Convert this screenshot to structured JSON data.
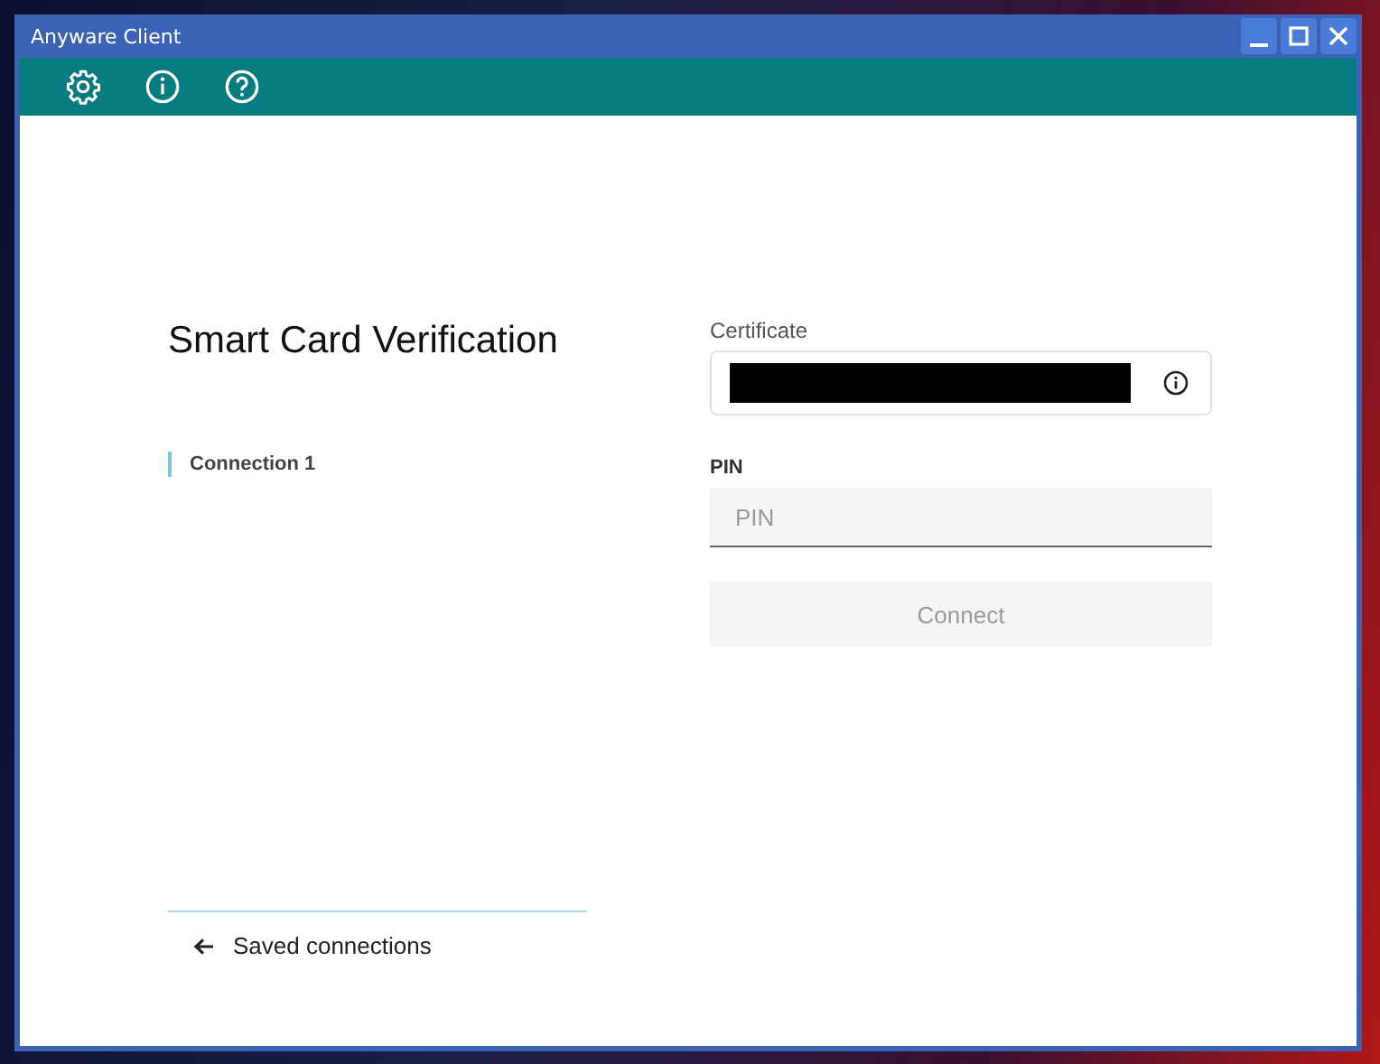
{
  "window": {
    "title": "Anyware Client"
  },
  "toolbar": {
    "buttons": [
      {
        "kind": "settings"
      },
      {
        "kind": "info"
      },
      {
        "kind": "help"
      }
    ]
  },
  "heading": "Smart Card Verification",
  "connection": {
    "label": "Connection 1"
  },
  "certificate": {
    "label": "Certificate",
    "redacted": true
  },
  "pin": {
    "label": "PIN",
    "placeholder": "PIN"
  },
  "connect_button": {
    "label": "Connect",
    "disabled": true
  },
  "saved_connections": {
    "label": "Saved connections"
  }
}
